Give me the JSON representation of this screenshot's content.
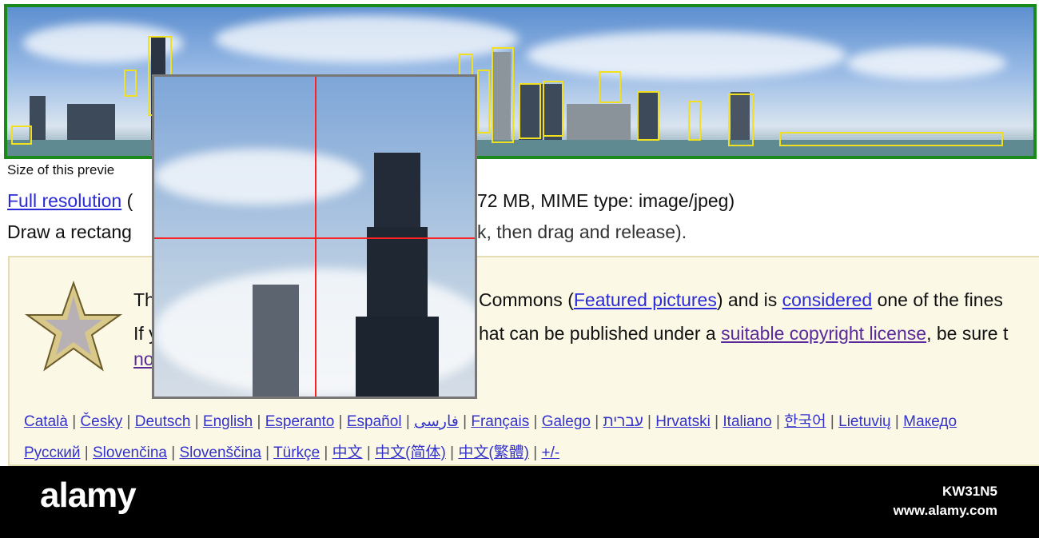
{
  "preview": {
    "size_text": "Size of this previe"
  },
  "file_info": {
    "full_resolution_link": "Full resolution",
    "paren_open": "(",
    "details_tail": "72 MB, MIME type: image/jpeg)"
  },
  "instructions": {
    "start": "Draw a rectang",
    "end": "k, then drag and release)."
  },
  "featured": {
    "line1_start": "Th",
    "line1_mid": "Commons (",
    "featured_link": "Featured pictures",
    "line1_and": ") and is ",
    "considered_link": "considered",
    "line1_end": " one of the fines",
    "line2_start": "If y",
    "line2_mid": "hat can be published under a ",
    "license_link": "suitable copyright license",
    "line2_end": ", be sure t",
    "line3_start": "no"
  },
  "languages_row1": [
    "Català",
    "Česky",
    "Deutsch",
    "English",
    "Esperanto",
    "Español",
    "فارسی",
    "Français",
    "Galego",
    "עברית",
    "Hrvatski",
    "Italiano",
    "한국어",
    "Lietuvių",
    "Македо"
  ],
  "languages_row2": [
    "Русский",
    "Slovenčina",
    "Slovenščina",
    "Türkçe",
    "中文",
    "中文(简体)",
    "中文(繁體)",
    "+/-"
  ],
  "footer": {
    "logo": "alamy",
    "image_id": "KW31N5",
    "site": "www.alamy.com"
  },
  "colors": {
    "border_green": "#1a8a1a",
    "box_yellow": "#f0e020",
    "crosshair": "#ff2020"
  }
}
